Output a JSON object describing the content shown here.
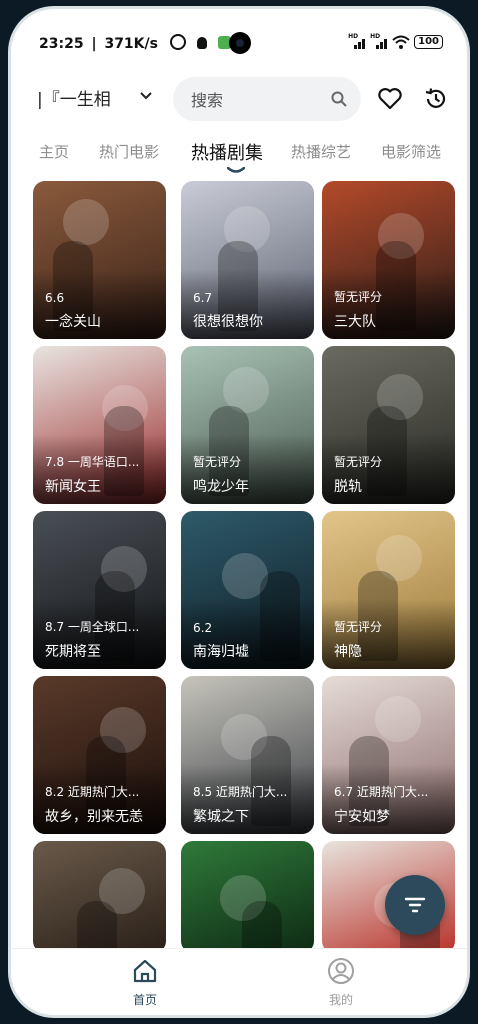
{
  "status_bar": {
    "time": "23:25",
    "separator": "|",
    "speed": "371K/s",
    "battery": "100"
  },
  "header": {
    "source_selector": "|『一生相",
    "search_placeholder": "搜索"
  },
  "tabs": [
    {
      "label": "主页",
      "active": false
    },
    {
      "label": "热门电影",
      "active": false
    },
    {
      "label": "热播剧集",
      "active": true
    },
    {
      "label": "热播综艺",
      "active": false
    },
    {
      "label": "电影筛选",
      "active": false
    }
  ],
  "cards": [
    {
      "score": "6.6",
      "title": "一念关山",
      "colors": [
        "#8a5a3c",
        "#3a2218"
      ]
    },
    {
      "score": "6.7",
      "title": "很想很想你",
      "colors": [
        "#c9ccd6",
        "#5d6272"
      ]
    },
    {
      "score": "暂无评分",
      "title": "三大队",
      "colors": [
        "#b44a2a",
        "#2a1c18"
      ]
    },
    {
      "score": "7.8 一周华语口...",
      "title": "新闻女王",
      "colors": [
        "#e8e4e0",
        "#9a2a2a"
      ]
    },
    {
      "score": "暂无评分",
      "title": "鸣龙少年",
      "colors": [
        "#a9c2b6",
        "#4a5a50"
      ]
    },
    {
      "score": "暂无评分",
      "title": "脱轨",
      "colors": [
        "#6a6a60",
        "#2a2a26"
      ]
    },
    {
      "score": "8.7 一周全球口...",
      "title": "死期将至",
      "colors": [
        "#4a4f56",
        "#121416"
      ]
    },
    {
      "score": "6.2",
      "title": "南海归墟",
      "colors": [
        "#2e5a6a",
        "#0e1c24"
      ]
    },
    {
      "score": "暂无评分",
      "title": "神隐",
      "colors": [
        "#e3c58a",
        "#9c7a3a"
      ]
    },
    {
      "score": "8.2 近期热门大...",
      "title": "故乡，别来无恙",
      "colors": [
        "#5a3a2a",
        "#1a0e0a"
      ]
    },
    {
      "score": "8.5 近期热门大...",
      "title": "繁城之下",
      "colors": [
        "#c6c4bc",
        "#3a3e44"
      ]
    },
    {
      "score": "6.7 近期热门大...",
      "title": "宁安如梦",
      "colors": [
        "#e6dcd6",
        "#8a6a6a"
      ]
    },
    {
      "score": "",
      "title": "",
      "colors": [
        "#6a5a4a",
        "#2a2018"
      ]
    },
    {
      "score": "",
      "title": "",
      "colors": [
        "#2f7a3a",
        "#0e2a14"
      ]
    },
    {
      "score": "",
      "title": "",
      "colors": [
        "#e8e4de",
        "#b8322a"
      ]
    }
  ],
  "bottom_nav": {
    "home_label": "首页",
    "me_label": "我的"
  },
  "theme": {
    "accent": "#2c4a5c",
    "tab_inactive": "#8c8c8c"
  }
}
